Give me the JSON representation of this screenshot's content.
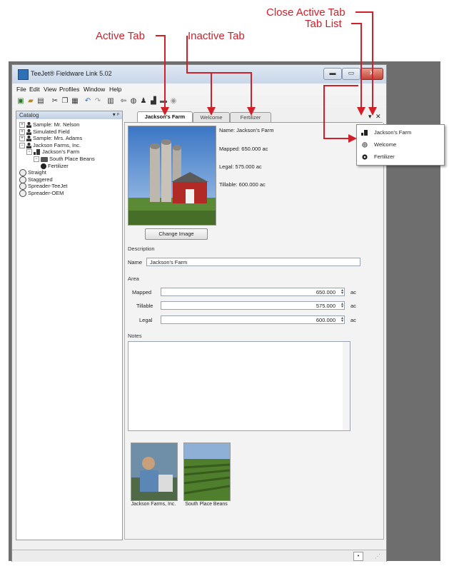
{
  "callouts": {
    "close_active_tab": "Close Active Tab",
    "tab_list": "Tab List",
    "active_tab": "Active Tab",
    "inactive_tab": "Inactive Tab"
  },
  "window": {
    "title": "TeeJet® Fieldware Link 5.02",
    "minimize_icon": "minimize-icon",
    "maximize_icon": "maximize-icon",
    "close_icon": "close-icon"
  },
  "menu": [
    "File",
    "Edit",
    "View",
    "Profiles",
    "Window",
    "Help"
  ],
  "catalog": {
    "title": "Catalog",
    "pin": "▾ ᵖ",
    "items": [
      {
        "label": "Sample: Mr. Nelson",
        "icon": "person-icon",
        "level": 0,
        "expander": "+"
      },
      {
        "label": "Simulated Field",
        "icon": "person-icon",
        "level": 0,
        "expander": "+"
      },
      {
        "label": "Sample: Mrs. Adams",
        "icon": "person-icon",
        "level": 0,
        "expander": "+"
      },
      {
        "label": "Jackson Farms, Inc.",
        "icon": "person-icon",
        "level": 0,
        "expander": "−"
      },
      {
        "label": "Jackson's Farm",
        "icon": "farm-icon",
        "level": 1,
        "expander": "−"
      },
      {
        "label": "South Place Beans",
        "icon": "folder-icon",
        "level": 2,
        "expander": "−"
      },
      {
        "label": "Fertilizer",
        "icon": "field-icon",
        "level": 3,
        "expander": ""
      },
      {
        "label": "Straight",
        "icon": "globe-icon",
        "level": 0,
        "expander": ""
      },
      {
        "label": "Staggered",
        "icon": "globe-icon",
        "level": 0,
        "expander": ""
      },
      {
        "label": "Spreader-TeeJet",
        "icon": "globe-icon",
        "level": 0,
        "expander": ""
      },
      {
        "label": "Spreader-OEM",
        "icon": "globe-icon",
        "level": 0,
        "expander": ""
      }
    ]
  },
  "tabs": [
    {
      "label": "Jackson's Farm",
      "active": true
    },
    {
      "label": "Welcome",
      "active": false
    },
    {
      "label": "Fertilizer",
      "active": false
    }
  ],
  "tab_controls": {
    "list": "▾",
    "close": "✕"
  },
  "summary": {
    "name": "Name: Jackson's Farm",
    "mapped": "Mapped: 650.000 ac",
    "legal": "Legal: 575.000 ac",
    "tillable": "Tillable: 600.000 ac"
  },
  "change_image": "Change Image",
  "description": {
    "section": "Description",
    "name_label": "Name",
    "name_value": "Jackson's Farm"
  },
  "area": {
    "section": "Area",
    "rows": [
      {
        "label": "Mapped",
        "value": "650.000",
        "unit": "ac"
      },
      {
        "label": "Tillable",
        "value": "575.000",
        "unit": "ac"
      },
      {
        "label": "Legal",
        "value": "600.000",
        "unit": "ac"
      }
    ]
  },
  "notes": {
    "section": "Notes",
    "value": ""
  },
  "thumbnails": [
    {
      "caption": "Jackson Farms, Inc."
    },
    {
      "caption": "South Place Beans"
    }
  ],
  "tab_list_menu": [
    {
      "label": "Jackson's Farm",
      "icon": "farm-icon"
    },
    {
      "label": "Welcome",
      "icon": "globe-icon"
    },
    {
      "label": "Fertilizer",
      "icon": "field-icon"
    }
  ]
}
